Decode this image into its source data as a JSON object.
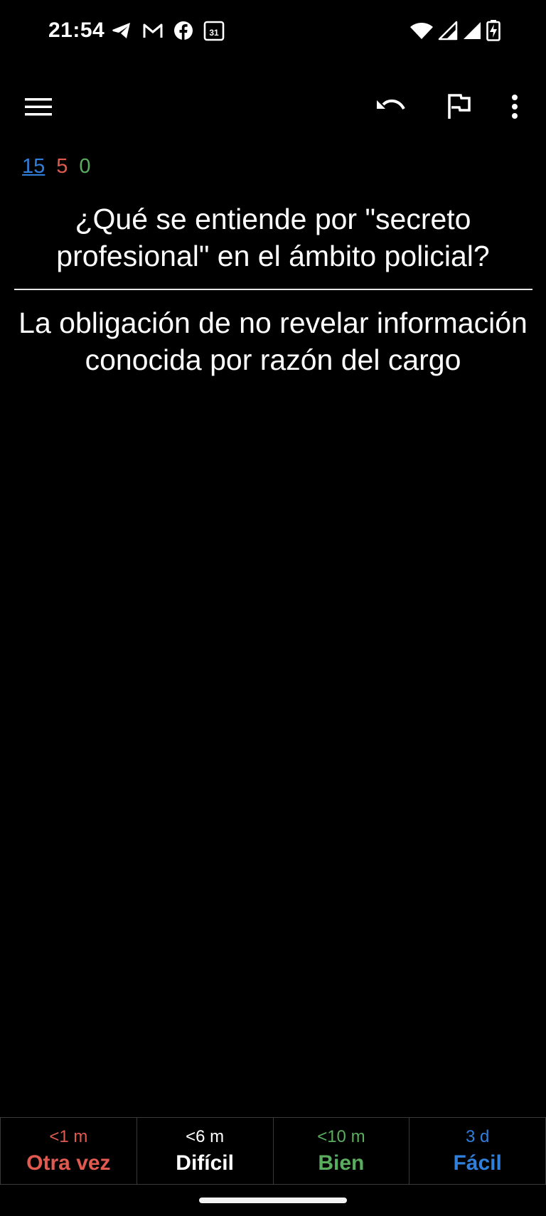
{
  "status_bar": {
    "time": "21:54",
    "left_icons": [
      "telegram-icon",
      "gmail-icon",
      "facebook-icon",
      "calendar-icon"
    ],
    "calendar_day": "31",
    "right_icons": [
      "wifi-icon",
      "signal-icon",
      "signal-icon",
      "battery-charging-icon"
    ]
  },
  "toolbar": {
    "icons": [
      "menu-icon",
      "undo-icon",
      "flag-icon",
      "more-vert-icon"
    ]
  },
  "counts": {
    "new": "15",
    "learning": "5",
    "review": "0"
  },
  "card": {
    "question": "¿Qué se entiende por \"secreto profesional\" en el ámbito policial?",
    "answer": "La obligación de no revelar información conocida por razón del cargo"
  },
  "answer_buttons": [
    {
      "time": "<1 m",
      "label": "Otra vez"
    },
    {
      "time": "<6 m",
      "label": "Difícil"
    },
    {
      "time": "<10 m",
      "label": "Bien"
    },
    {
      "time": "3 d",
      "label": "Fácil"
    }
  ],
  "colors": {
    "again": "#e05a50",
    "good": "#5aad5e",
    "easy": "#2f7fdc",
    "background": "#000000"
  }
}
